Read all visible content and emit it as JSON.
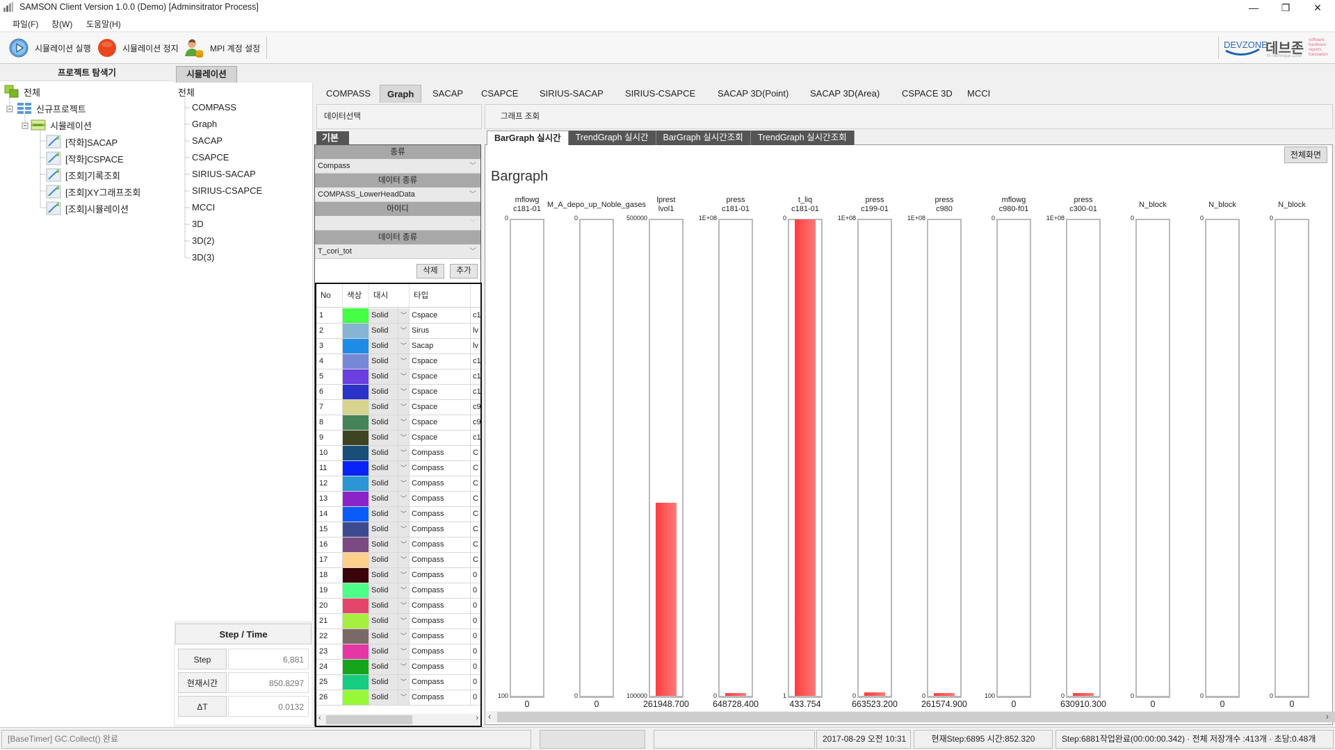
{
  "window": {
    "title": "SAMSON Client Version 1.0.0 (Demo) [Adminsitrator Process]",
    "controls": [
      "—",
      "❐",
      "✕"
    ]
  },
  "menu": [
    "파일(F)",
    "창(W)",
    "도움말(H)"
  ],
  "toolbar": {
    "run_label": "시뮬레이션 실행",
    "stop_label": "시뮬레이션 정지",
    "mpi_label": "MPI 계정 설정",
    "logo_text": "DEVZONE",
    "logo_korean": "데브존",
    "logo_sub": "Hi Technique Zone",
    "logo_tags": [
      "software",
      "hardware",
      "reports",
      "translation"
    ]
  },
  "explorer": {
    "title": "프로젝트 탐색기",
    "items": [
      {
        "label": "전체",
        "level": 0,
        "icon": "folder-group-icon"
      },
      {
        "label": "신규프로젝트",
        "level": 1,
        "icon": "project-grid-icon"
      },
      {
        "label": "시뮬레이션",
        "level": 2,
        "icon": "simulation-icon"
      },
      {
        "label": "[작화]SACAP",
        "level": 3,
        "icon": "chart-icon"
      },
      {
        "label": "[작화]CSPACE",
        "level": 3,
        "icon": "chart-icon"
      },
      {
        "label": "[조회]기록조회",
        "level": 3,
        "icon": "chart-icon"
      },
      {
        "label": "[조회]XY그래프조회",
        "level": 3,
        "icon": "chart-icon"
      },
      {
        "label": "[조회]시뮬레이션",
        "level": 3,
        "icon": "chart-icon"
      }
    ]
  },
  "simulation": {
    "tab_label": "시뮬레이션",
    "root": "전체",
    "items": [
      "COMPASS",
      "Graph",
      "SACAP",
      "CSAPCE",
      "SIRIUS-SACAP",
      "SIRIUS-CSAPCE",
      "MCCI",
      "3D",
      "3D(2)",
      "3D(3)"
    ]
  },
  "step_time": {
    "title": "Step / Time",
    "rows": [
      {
        "label": "Step",
        "value": "6,881"
      },
      {
        "label": "현재시간",
        "value": "850.8297"
      },
      {
        "label": "ΔT",
        "value": "0.0132"
      }
    ]
  },
  "main_tabs": {
    "items": [
      "COMPASS",
      "Graph",
      "SACAP",
      "CSAPCE",
      "SIRIUS-SACAP",
      "SIRIUS-CSAPCE",
      "SACAP 3D(Point)",
      "SACAP 3D(Area)",
      "CSPACE 3D",
      "MCCI"
    ],
    "active": 1
  },
  "data_select": {
    "header": "데이터선택",
    "tab": "기본",
    "fields": [
      {
        "label": "종류",
        "value": "Compass"
      },
      {
        "label": "데이터 종류",
        "value": "COMPASS_LowerHeadData"
      },
      {
        "label": "아이디",
        "value": ""
      },
      {
        "label": "데이터 종류",
        "value": "T_cori_tot"
      }
    ],
    "delete_label": "삭제",
    "add_label": "추가",
    "grid": {
      "columns": [
        "No",
        "색상",
        "대시",
        "타입",
        ""
      ],
      "rows": [
        {
          "no": "1",
          "color": "#44ff44",
          "dash": "Solid",
          "type": "Cspace",
          "more": "c1"
        },
        {
          "no": "2",
          "color": "#86b4d2",
          "dash": "Solid",
          "type": "Sirus",
          "more": "lv"
        },
        {
          "no": "3",
          "color": "#1e8ce6",
          "dash": "Solid",
          "type": "Sacap",
          "more": "lv"
        },
        {
          "no": "4",
          "color": "#7788d6",
          "dash": "Solid",
          "type": "Cspace",
          "more": "c1"
        },
        {
          "no": "5",
          "color": "#6a3ee0",
          "dash": "Solid",
          "type": "Cspace",
          "more": "c1"
        },
        {
          "no": "6",
          "color": "#2a32c8",
          "dash": "Solid",
          "type": "Cspace",
          "more": "c1"
        },
        {
          "no": "7",
          "color": "#d6d48e",
          "dash": "Solid",
          "type": "Cspace",
          "more": "c9"
        },
        {
          "no": "8",
          "color": "#458458",
          "dash": "Solid",
          "type": "Cspace",
          "more": "c9"
        },
        {
          "no": "9",
          "color": "#3e4422",
          "dash": "Solid",
          "type": "Cspace",
          "more": "c1"
        },
        {
          "no": "10",
          "color": "#184e78",
          "dash": "Solid",
          "type": "Compass",
          "more": "C"
        },
        {
          "no": "11",
          "color": "#0822f8",
          "dash": "Solid",
          "type": "Compass",
          "more": "C"
        },
        {
          "no": "12",
          "color": "#2a96d4",
          "dash": "Solid",
          "type": "Compass",
          "more": "C"
        },
        {
          "no": "13",
          "color": "#8a24c8",
          "dash": "Solid",
          "type": "Compass",
          "more": "C"
        },
        {
          "no": "14",
          "color": "#0a5cfa",
          "dash": "Solid",
          "type": "Compass",
          "more": "C"
        },
        {
          "no": "15",
          "color": "#3e4a90",
          "dash": "Solid",
          "type": "Compass",
          "more": "C"
        },
        {
          "no": "16",
          "color": "#7a4a80",
          "dash": "Solid",
          "type": "Compass",
          "more": "C"
        },
        {
          "no": "17",
          "color": "#ffd08a",
          "dash": "Solid",
          "type": "Compass",
          "more": "C"
        },
        {
          "no": "18",
          "color": "#3a0408",
          "dash": "Solid",
          "type": "Compass",
          "more": "0"
        },
        {
          "no": "19",
          "color": "#4cff86",
          "dash": "Solid",
          "type": "Compass",
          "more": "0"
        },
        {
          "no": "20",
          "color": "#e4466a",
          "dash": "Solid",
          "type": "Compass",
          "more": "0"
        },
        {
          "no": "21",
          "color": "#a6ee40",
          "dash": "Solid",
          "type": "Compass",
          "more": "0"
        },
        {
          "no": "22",
          "color": "#7a6a66",
          "dash": "Solid",
          "type": "Compass",
          "more": "0"
        },
        {
          "no": "23",
          "color": "#e636a6",
          "dash": "Solid",
          "type": "Compass",
          "more": "0"
        },
        {
          "no": "24",
          "color": "#16a41a",
          "dash": "Solid",
          "type": "Compass",
          "more": "0"
        },
        {
          "no": "25",
          "color": "#16cc80",
          "dash": "Solid",
          "type": "Compass",
          "more": "0"
        },
        {
          "no": "26",
          "color": "#96f836",
          "dash": "Solid",
          "type": "Compass",
          "more": "0"
        }
      ]
    }
  },
  "graph_query": {
    "header": "그래프 조회",
    "tabs": [
      "BarGraph 실시간",
      "TrendGraph 실시간",
      "BarGraph 실시간조회",
      "TrendGraph 실시간조회"
    ],
    "active_tab": 0,
    "fullscreen_label": "전체화면"
  },
  "chart_data": {
    "type": "bar",
    "title": "Bargraph",
    "bar_color": "#ff4a4a",
    "bars": [
      {
        "label1": "mflowg",
        "label2": "c181-01",
        "axis_top": "0",
        "axis_bottom": "100",
        "value": 0,
        "value_label": "0",
        "fill": 0
      },
      {
        "label1": "M_A_depo_up_Noble_gases",
        "label2": "",
        "axis_top": "0",
        "axis_bottom": "0",
        "value": 0,
        "value_label": "0",
        "fill": 0
      },
      {
        "label1": "lprest",
        "label2": "lvol1",
        "axis_top": "500000",
        "axis_bottom": "100000",
        "value": 261948.7,
        "value_label": "261948.700",
        "fill": 0.405
      },
      {
        "label1": "press",
        "label2": "c181-01",
        "axis_top": "1E+08",
        "axis_bottom": "0",
        "value": 648728.4,
        "value_label": "648728.400",
        "fill": 0.0065
      },
      {
        "label1": "t_liq",
        "label2": "c181-01",
        "axis_top": "0",
        "axis_bottom": "1",
        "value": 433.754,
        "value_label": "433.754",
        "fill": 1.0
      },
      {
        "label1": "press",
        "label2": "c199-01",
        "axis_top": "1E+08",
        "axis_bottom": "0",
        "value": 663523.2,
        "value_label": "663523.200",
        "fill": 0.0066
      },
      {
        "label1": "press",
        "label2": "c980",
        "axis_top": "1E+08",
        "axis_bottom": "0",
        "value": 261574.9,
        "value_label": "261574.900",
        "fill": 0.0026
      },
      {
        "label1": "mflowg",
        "label2": "c980-f01",
        "axis_top": "0",
        "axis_bottom": "100",
        "value": 0,
        "value_label": "0",
        "fill": 0
      },
      {
        "label1": "press",
        "label2": "c300-01",
        "axis_top": "1E+08",
        "axis_bottom": "0",
        "value": 630910.3,
        "value_label": "630910.300",
        "fill": 0.0063
      },
      {
        "label1": "N_block",
        "label2": "",
        "axis_top": "0",
        "axis_bottom": "0",
        "value": 0,
        "value_label": "0",
        "fill": 0
      },
      {
        "label1": "N_block",
        "label2": "",
        "axis_top": "0",
        "axis_bottom": "0",
        "value": 0,
        "value_label": "0",
        "fill": 0
      },
      {
        "label1": "N_block",
        "label2": "",
        "axis_top": "0",
        "axis_bottom": "0",
        "value": 0,
        "value_label": "0",
        "fill": 0
      }
    ]
  },
  "statusbar": {
    "message": "[BaseTimer] GC.Collect() 완료",
    "datetime": "2017-08-29 오전 10:31",
    "current": "현재Step:6895 시간:852.320",
    "summary": "Step:6881작업완료(00:00:00.342) · 전체 저장개수 :413개 · 초당:0.48개"
  }
}
